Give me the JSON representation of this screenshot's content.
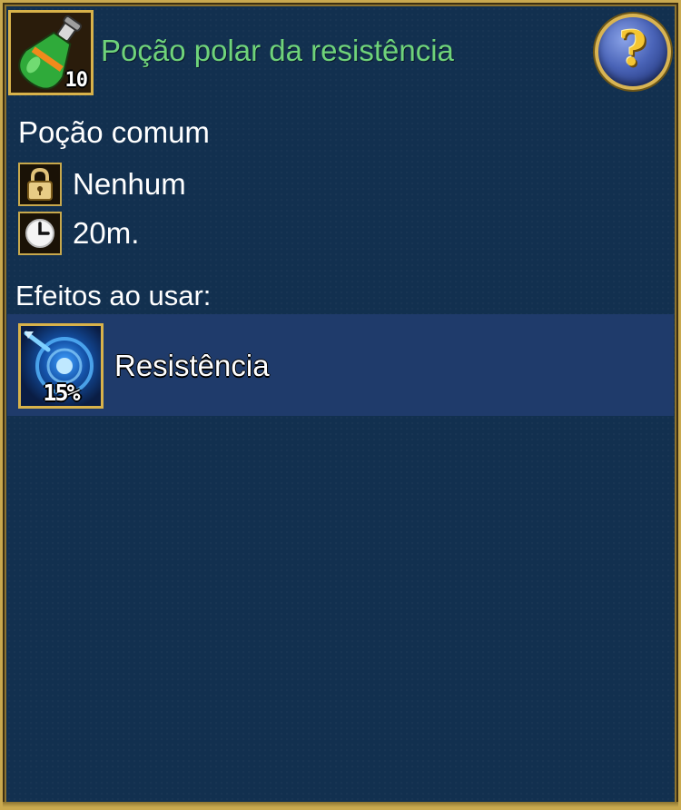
{
  "item": {
    "name": "Poção polar da resistência",
    "icon": "green-potion-icon",
    "count": "10",
    "type": "Poção comum",
    "title_color": "#6fd37a"
  },
  "help": {
    "symbol": "?",
    "icon": "help-icon"
  },
  "info": {
    "binding_icon": "lock-icon",
    "binding": "Nenhum",
    "cooldown_icon": "clock-icon",
    "cooldown": "20m."
  },
  "effects": {
    "title": "Efeitos ao usar:",
    "list": [
      {
        "icon": "resistance-buff-icon",
        "value": "15%",
        "name": "Resistência"
      }
    ]
  },
  "colors": {
    "panel_bg": "#12304f",
    "border_gold": "#c9a94f",
    "effect_row_bg": "#1f3b6b"
  }
}
